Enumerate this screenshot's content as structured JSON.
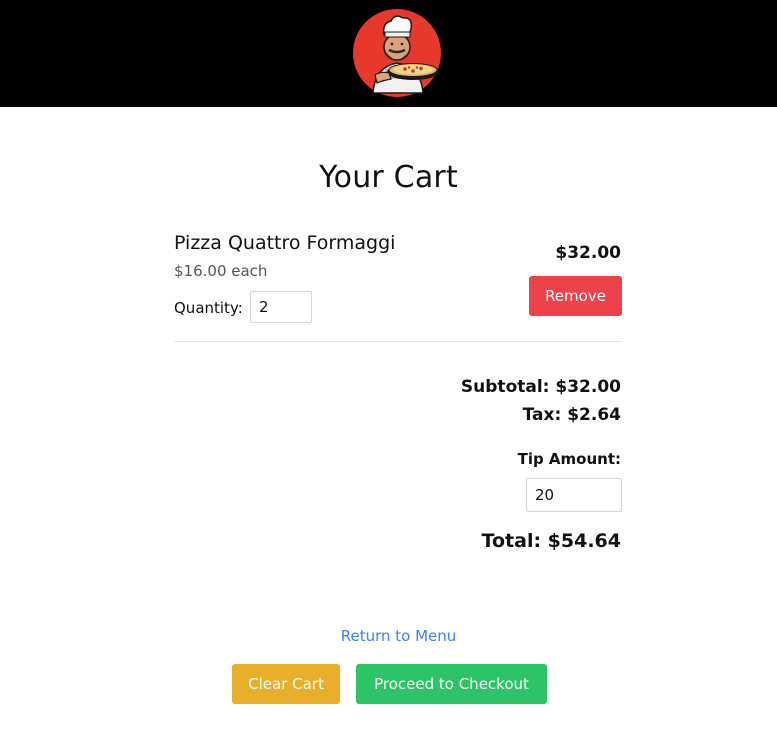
{
  "header": {
    "logo_icon": "pizza-chef-logo-icon",
    "background_color": "#000000",
    "logo_circle_color": "#e8382c"
  },
  "cart": {
    "title": "Your Cart",
    "items": [
      {
        "name": "Pizza Quattro Formaggi",
        "unit_price": "$16.00 each",
        "quantity_label": "Quantity:",
        "quantity": "2",
        "line_total": "$32.00",
        "remove_label": "Remove"
      }
    ]
  },
  "summary": {
    "subtotal": "Subtotal: $32.00",
    "tax": "Tax: $2.64",
    "tip_label": "Tip Amount:",
    "tip_value": "20",
    "total": "Total: $54.64"
  },
  "actions": {
    "return_link": "Return to Menu",
    "clear_cart": "Clear Cart",
    "checkout": "Proceed to Checkout"
  },
  "colors": {
    "remove": "#ef4149",
    "clear": "#e9ae2a",
    "checkout": "#2cc466",
    "link": "#3b82f6"
  }
}
